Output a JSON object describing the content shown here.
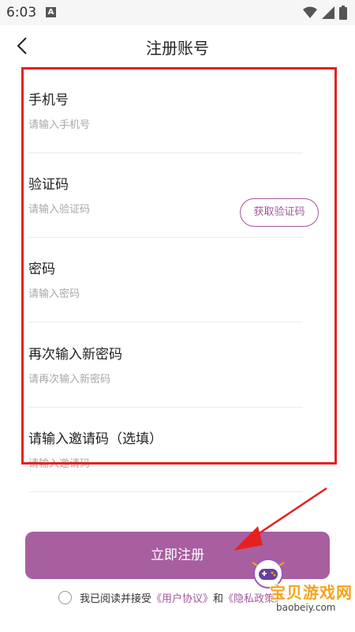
{
  "status_bar": {
    "time": "6:03",
    "notification_letter": "A"
  },
  "header": {
    "title": "注册账号"
  },
  "form": {
    "fields": [
      {
        "label": "手机号",
        "placeholder": "请输入手机号",
        "value": ""
      },
      {
        "label": "验证码",
        "placeholder": "请输入验证码",
        "value": "",
        "action_label": "获取验证码"
      },
      {
        "label": "密码",
        "placeholder": "请输入密码",
        "value": ""
      },
      {
        "label": "再次输入新密码",
        "placeholder": "请再次输入新密码",
        "value": ""
      },
      {
        "label": "请输入邀请码（选填）",
        "placeholder": "请输入邀请码",
        "value": ""
      }
    ]
  },
  "submit": {
    "label": "立即注册"
  },
  "agreement": {
    "prefix": "我已阅读并接受",
    "user_agreement": "《用户协议》",
    "joiner": "和",
    "privacy_policy": "《隐私政策》"
  },
  "watermark": {
    "name": "宝贝游戏网",
    "url": "baobeiy.com"
  },
  "colors": {
    "accent": "#a85fa0",
    "highlight": "#e62020"
  }
}
